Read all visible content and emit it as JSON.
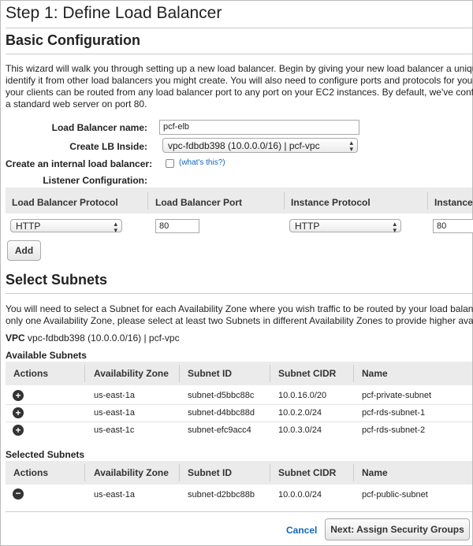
{
  "page": {
    "step_title": "Step 1: Define Load Balancer"
  },
  "basic": {
    "title": "Basic Configuration",
    "intro": [
      "This wizard will walk you through setting up a new load balancer. Begin by giving your new load balancer a unique n",
      "identify it from other load balancers you might create. You will also need to configure ports and protocols for your lo",
      "your clients can be routed from any load balancer port to any port on your EC2 instances. By default, we've configu",
      "a standard web server on port 80."
    ],
    "name_label": "Load Balancer name:",
    "name_value": "pcf-elb",
    "create_label": "Create LB Inside:",
    "create_value": "vpc-fdbdb398 (10.0.0.0/16) | pcf-vpc",
    "internal_label": "Create an internal load balancer:",
    "internal_checked": false,
    "whats_this": "(what's this?)",
    "listener_label": "Listener Configuration:"
  },
  "listener": {
    "headers": [
      "Load Balancer Protocol",
      "Load Balancer Port",
      "Instance Protocol",
      "Instance"
    ],
    "lb_protocol": "HTTP",
    "lb_port": "80",
    "instance_protocol": "HTTP",
    "instance_port": "80",
    "add_label": "Add"
  },
  "subnets": {
    "title": "Select Subnets",
    "intro": [
      "You will need to select a Subnet for each Availability Zone where you wish traffic to be routed by your load balancer",
      "only one Availability Zone, please select at least two Subnets in different Availability Zones to provide higher availab"
    ],
    "vpc_label": "VPC",
    "vpc_value": "vpc-fdbdb398 (10.0.0.0/16) | pcf-vpc",
    "available_label": "Available Subnets",
    "selected_label": "Selected Subnets",
    "columns": [
      "Actions",
      "Availability Zone",
      "Subnet ID",
      "Subnet CIDR",
      "Name"
    ],
    "available": [
      {
        "zone": "us-east-1a",
        "id": "subnet-d5bbc88c",
        "cidr": "10.0.16.0/20",
        "name": "pcf-private-subnet"
      },
      {
        "zone": "us-east-1a",
        "id": "subnet-d4bbc88d",
        "cidr": "10.0.2.0/24",
        "name": "pcf-rds-subnet-1"
      },
      {
        "zone": "us-east-1c",
        "id": "subnet-efc9acc4",
        "cidr": "10.0.3.0/24",
        "name": "pcf-rds-subnet-2"
      }
    ],
    "selected": [
      {
        "zone": "us-east-1a",
        "id": "subnet-d2bbc88b",
        "cidr": "10.0.0.0/24",
        "name": "pcf-public-subnet"
      }
    ]
  },
  "footer": {
    "cancel": "Cancel",
    "next": "Next: Assign Security Groups"
  },
  "icons": {
    "add": "plus-circle-icon",
    "remove": "minus-circle-icon",
    "select_arrow": "up-down-arrows-icon"
  },
  "colors": {
    "link": "#1166bb",
    "header_band": "#ebebeb"
  }
}
